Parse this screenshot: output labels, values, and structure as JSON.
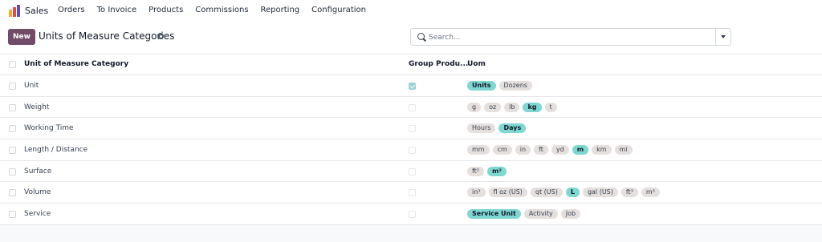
{
  "navbar": {
    "app_name": "Sales",
    "menu": [
      "Orders",
      "To Invoice",
      "Products",
      "Commissions",
      "Reporting",
      "Configuration"
    ]
  },
  "controlbar": {
    "new_label": "New",
    "title": "Units of Measure Categories",
    "search_placeholder": "Search..."
  },
  "table": {
    "headers": {
      "name": "Unit of Measure Category",
      "group": "Group Produ...",
      "uom": "Uom"
    },
    "rows": [
      {
        "name": "Unit",
        "group_checked": true,
        "uoms": [
          {
            "label": "Units",
            "active": true
          },
          {
            "label": "Dozens",
            "active": false
          }
        ]
      },
      {
        "name": "Weight",
        "group_checked": false,
        "uoms": [
          {
            "label": "g",
            "active": false
          },
          {
            "label": "oz",
            "active": false
          },
          {
            "label": "lb",
            "active": false
          },
          {
            "label": "kg",
            "active": true
          },
          {
            "label": "t",
            "active": false
          }
        ]
      },
      {
        "name": "Working Time",
        "group_checked": false,
        "uoms": [
          {
            "label": "Hours",
            "active": false
          },
          {
            "label": "Days",
            "active": true
          }
        ]
      },
      {
        "name": "Length / Distance",
        "group_checked": false,
        "uoms": [
          {
            "label": "mm",
            "active": false
          },
          {
            "label": "cm",
            "active": false
          },
          {
            "label": "in",
            "active": false
          },
          {
            "label": "ft",
            "active": false
          },
          {
            "label": "yd",
            "active": false
          },
          {
            "label": "m",
            "active": true
          },
          {
            "label": "km",
            "active": false
          },
          {
            "label": "mi",
            "active": false
          }
        ]
      },
      {
        "name": "Surface",
        "group_checked": false,
        "uoms": [
          {
            "label": "ft²",
            "active": false
          },
          {
            "label": "m²",
            "active": true
          }
        ]
      },
      {
        "name": "Volume",
        "group_checked": false,
        "uoms": [
          {
            "label": "in³",
            "active": false
          },
          {
            "label": "fl oz (US)",
            "active": false
          },
          {
            "label": "qt (US)",
            "active": false
          },
          {
            "label": "L",
            "active": true
          },
          {
            "label": "gal (US)",
            "active": false
          },
          {
            "label": "ft³",
            "active": false
          },
          {
            "label": "m³",
            "active": false
          }
        ]
      },
      {
        "name": "Service",
        "group_checked": false,
        "uoms": [
          {
            "label": "Service Unit",
            "active": true
          },
          {
            "label": "Activity",
            "active": false
          },
          {
            "label": "Job",
            "active": false
          }
        ]
      }
    ]
  },
  "colors": {
    "brand": "#714b67",
    "active_tag": "#7fd7d2",
    "tag": "#e5e0de"
  },
  "icons": [
    "sales-app-icon",
    "gear-icon",
    "search-icon",
    "caret-down-icon"
  ]
}
